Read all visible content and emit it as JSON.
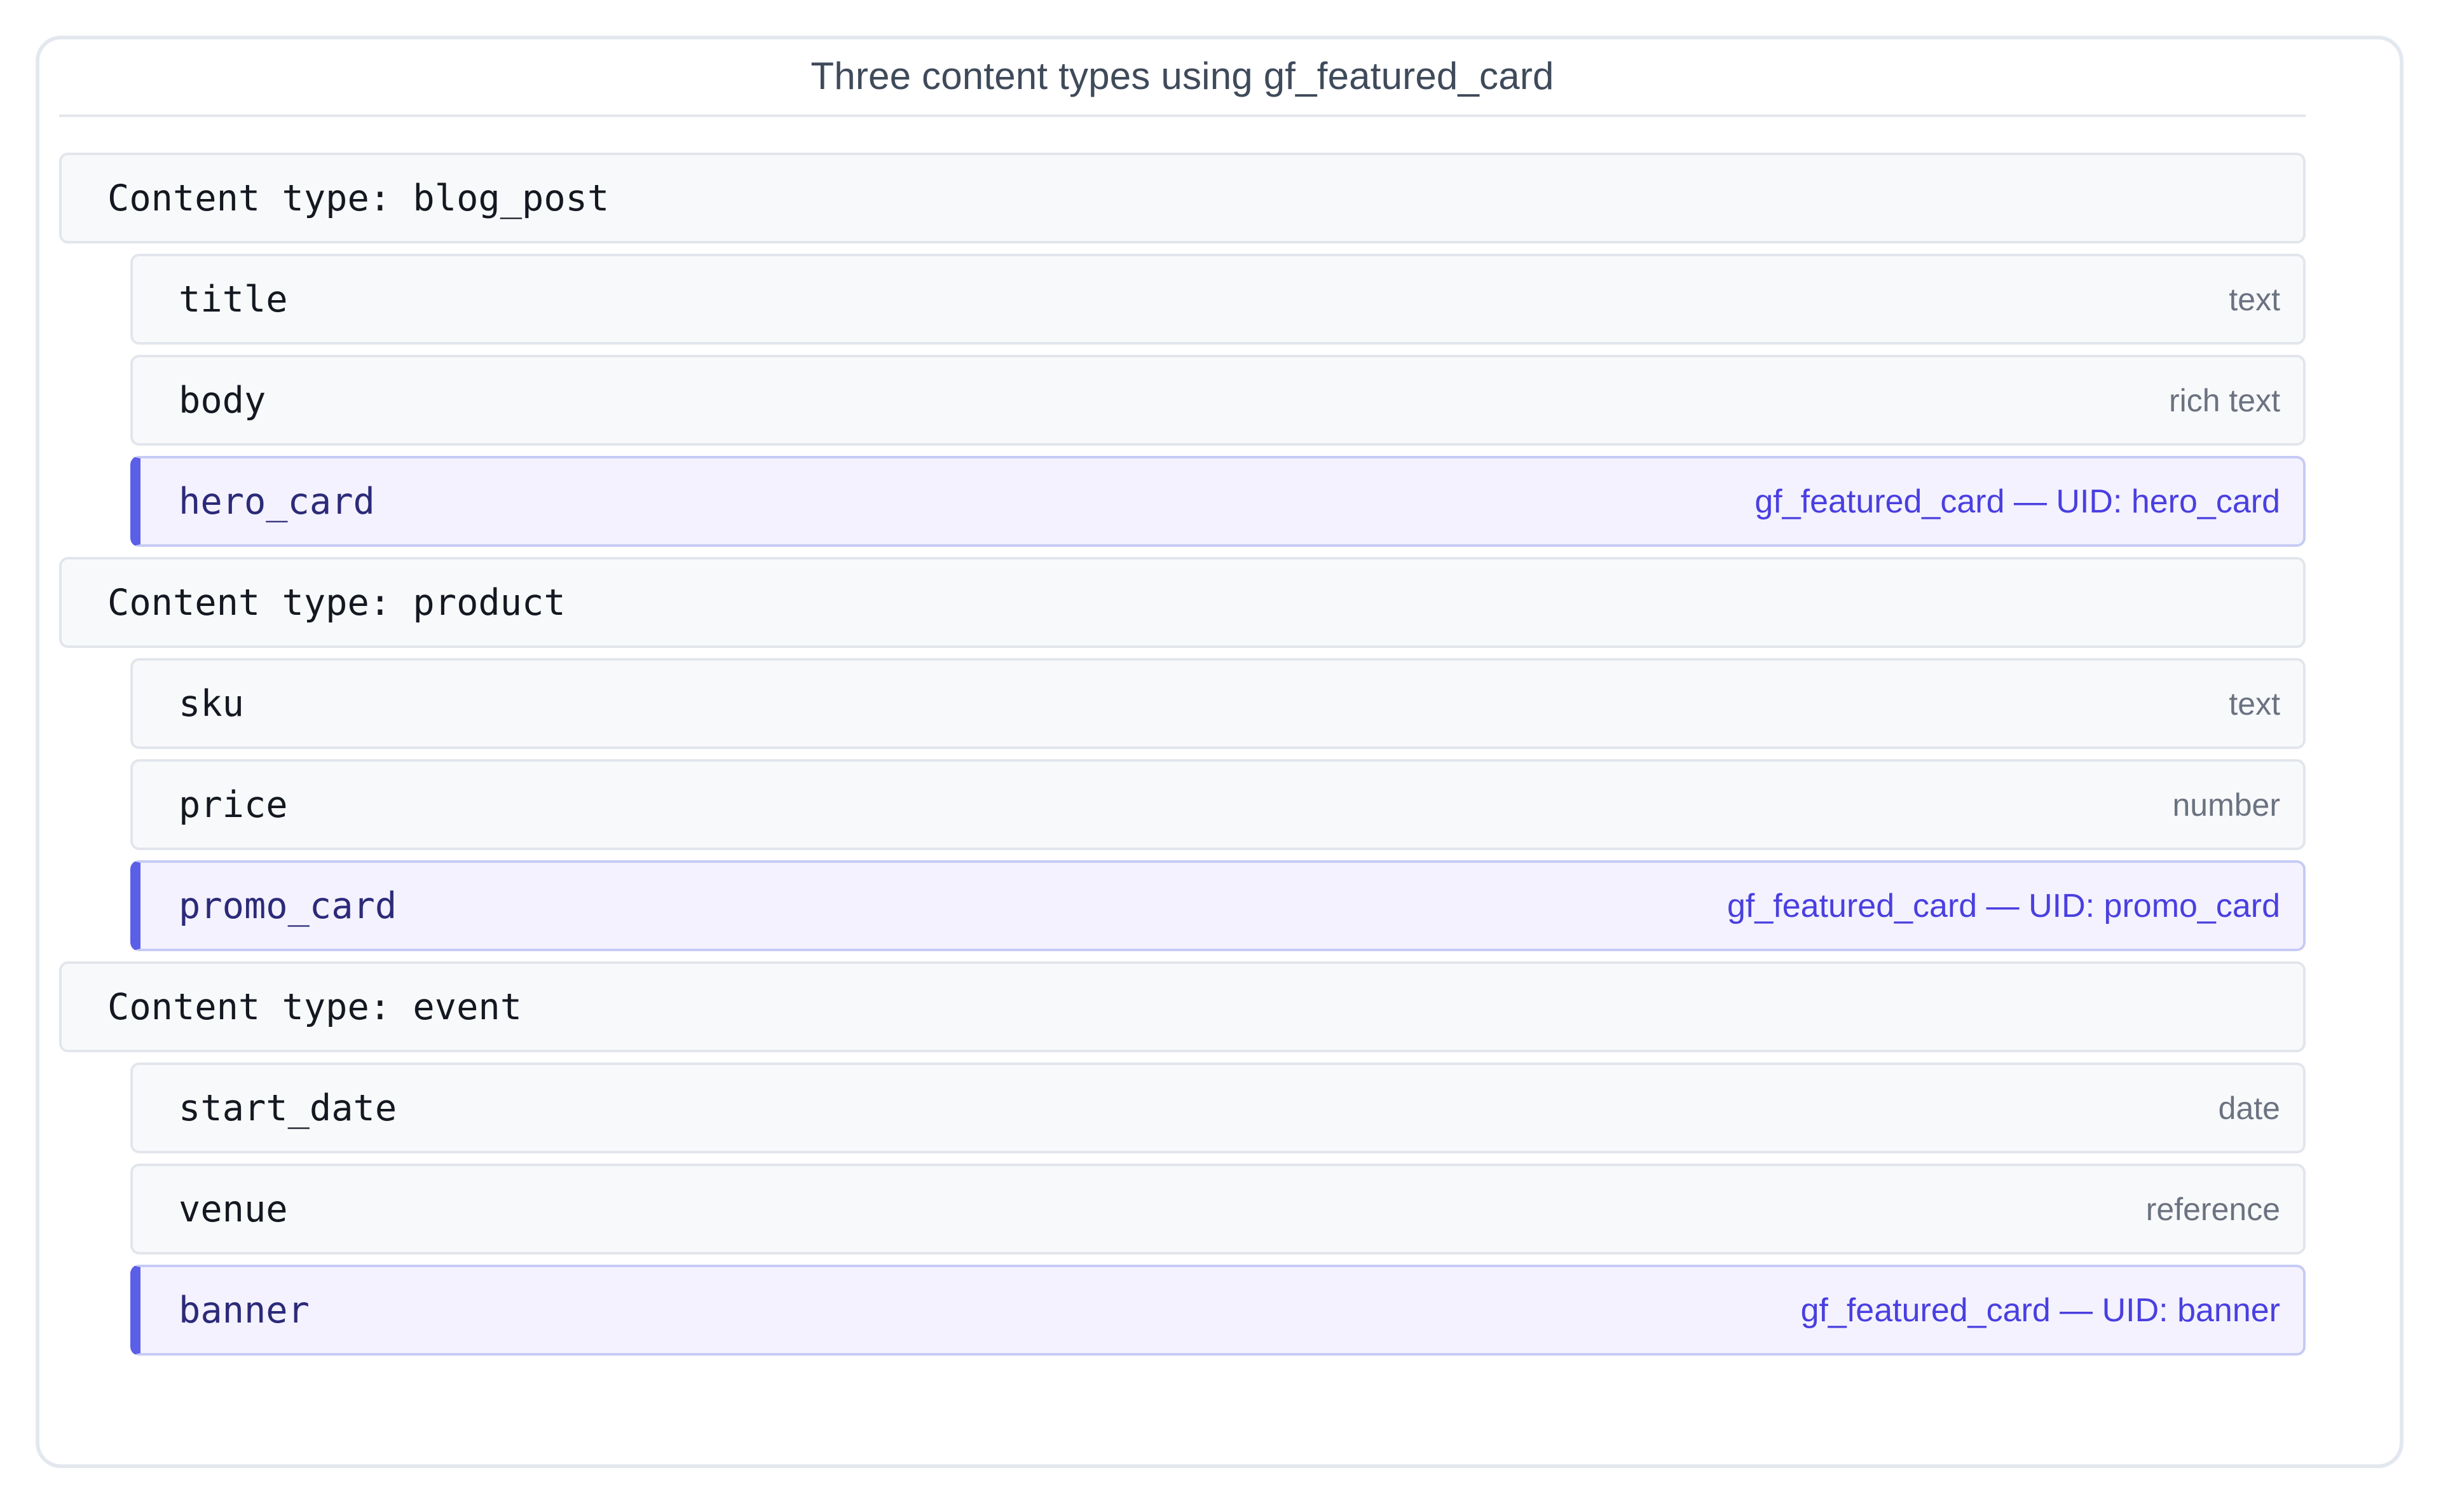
{
  "title": "Three content types using gf_featured_card",
  "colors": {
    "accent": "#5b5ee6",
    "accent_text": "#4a3fe0",
    "card_background": "#f3f2fe",
    "row_background": "#f8f9fb",
    "border": "#e2e6ec"
  },
  "content_types": [
    {
      "label": "Content type: blog_post",
      "fields": [
        {
          "name": "title",
          "type": "text",
          "is_featured_card": false
        },
        {
          "name": "body",
          "type": "rich text",
          "is_featured_card": false
        },
        {
          "name": "hero_card",
          "type": "gf_featured_card — UID: hero_card",
          "is_featured_card": true
        }
      ]
    },
    {
      "label": "Content type: product",
      "fields": [
        {
          "name": "sku",
          "type": "text",
          "is_featured_card": false
        },
        {
          "name": "price",
          "type": "number",
          "is_featured_card": false
        },
        {
          "name": "promo_card",
          "type": "gf_featured_card — UID: promo_card",
          "is_featured_card": true
        }
      ]
    },
    {
      "label": "Content type: event",
      "fields": [
        {
          "name": "start_date",
          "type": "date",
          "is_featured_card": false
        },
        {
          "name": "venue",
          "type": "reference",
          "is_featured_card": false
        },
        {
          "name": "banner",
          "type": "gf_featured_card — UID: banner",
          "is_featured_card": true
        }
      ]
    }
  ]
}
